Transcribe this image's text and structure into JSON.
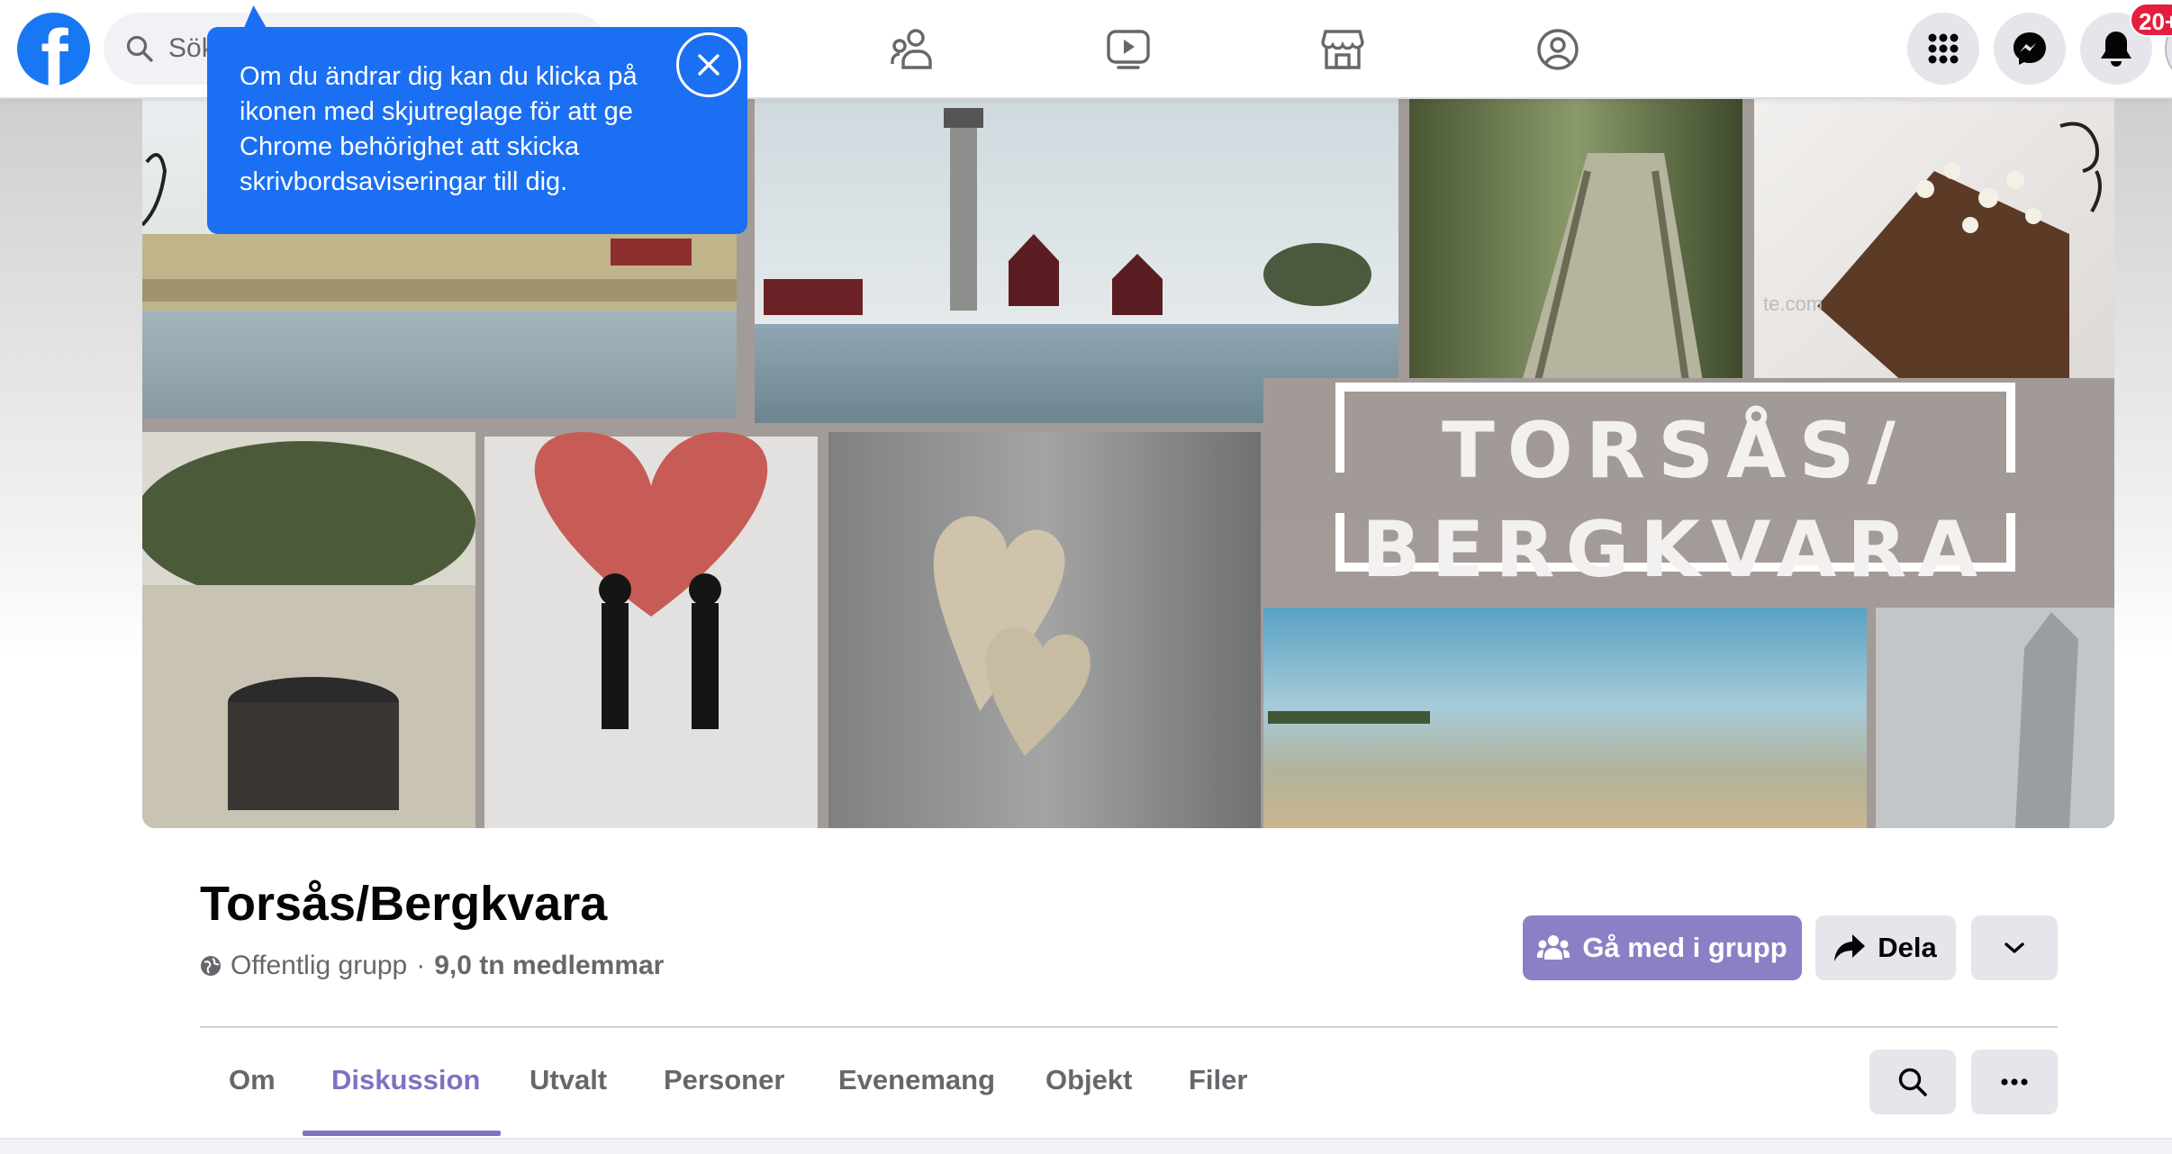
{
  "header": {
    "search_placeholder": "Sök på Facebook",
    "nav_icons": [
      "groups-icon",
      "watch-icon",
      "marketplace-icon",
      "gaming-icon"
    ],
    "right_icons": [
      "menu-grid-icon",
      "messenger-icon",
      "bell-icon"
    ],
    "notification_count": "20+"
  },
  "tooltip": {
    "text": "Om du ändrar dig kan du klicka på ikonen med skjutreglage för att ge Chrome behörighet att skicka skrivbordsaviseringar till dig."
  },
  "cover": {
    "title_line1": "TORSÅS/",
    "title_line2": "BERGKVARA",
    "watermark": "te.com"
  },
  "group": {
    "name": "Torsås/Bergkvara",
    "privacy": "Offentlig grupp",
    "separator": "·",
    "members": "9,0 tn medlemmar",
    "join_label": "Gå med i grupp",
    "share_label": "Dela"
  },
  "tabs": [
    {
      "label": "Om",
      "active": false
    },
    {
      "label": "Diskussion",
      "active": true
    },
    {
      "label": "Utvalt",
      "active": false
    },
    {
      "label": "Personer",
      "active": false
    },
    {
      "label": "Evenemang",
      "active": false
    },
    {
      "label": "Objekt",
      "active": false
    },
    {
      "label": "Filer",
      "active": false
    }
  ],
  "colors": {
    "facebook_blue": "#1877f2",
    "tooltip_blue": "#1b6ff3",
    "accent_purple": "#8b80c5",
    "active_tab": "#7c72c2",
    "badge_red": "#e41e3f"
  }
}
